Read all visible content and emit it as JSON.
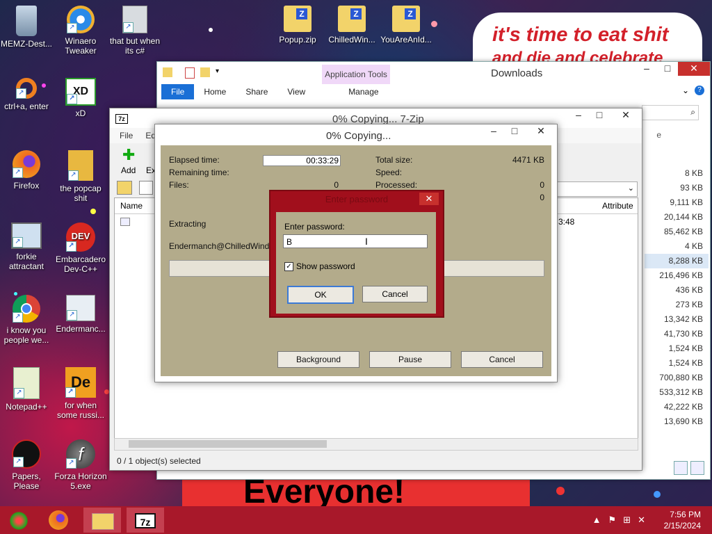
{
  "desktop": {
    "icons": [
      {
        "label": "MEMZ-Dest..."
      },
      {
        "label": "Winaero Tweaker"
      },
      {
        "label": "that but when its c#"
      },
      {
        "label": "Popup.zip"
      },
      {
        "label": "ChilledWin..."
      },
      {
        "label": "YouAreAnId..."
      },
      {
        "label": "ctrl+a, enter"
      },
      {
        "label": "xD"
      },
      {
        "label": "Firefox"
      },
      {
        "label": "the popcap shit"
      },
      {
        "label": "forkie attractant"
      },
      {
        "label": "Embarcadero Dev-C++"
      },
      {
        "label": "i know you people we..."
      },
      {
        "label": "Endermanc..."
      },
      {
        "label": "Notepad++"
      },
      {
        "label": "for when some russi..."
      },
      {
        "label": "Papers, Please"
      },
      {
        "label": "Forza Horizon 5.exe"
      }
    ],
    "banner_top_line1": "it's time to eat shit",
    "banner_top_line2": "and die and celebrate",
    "banner_bottom": "Everyone!"
  },
  "explorer": {
    "title": "Downloads",
    "context_tab": "Application Tools",
    "ribbon_tabs": [
      "File",
      "Home",
      "Share",
      "View",
      "Manage"
    ],
    "column_size_header": "e",
    "column_attr_header": "Attribute",
    "date_fragment": "3:48",
    "sizes": [
      "8 KB",
      "93 KB",
      "9,111 KB",
      "20,144 KB",
      "85,462 KB",
      "4 KB",
      "8,288 KB",
      "216,496 KB",
      "436 KB",
      "273 KB",
      "13,342 KB",
      "41,730 KB",
      "1,524 KB",
      "1,524 KB",
      "700,880 KB",
      "533,312 KB",
      "42,222 KB",
      "13,690 KB"
    ]
  },
  "zip_main": {
    "title": "0% Copying... 7-Zip",
    "logo": "7z",
    "menu": [
      "File",
      "Edit"
    ],
    "toolbar": {
      "add": "Add",
      "extract": "Ext"
    },
    "column_name": "Name",
    "status": "0 / 1 object(s) selected"
  },
  "progress": {
    "title": "0% Copying...",
    "elapsed_label": "Elapsed time:",
    "elapsed_value": "00:33:29",
    "remaining_label": "Remaining time:",
    "files_label": "Files:",
    "files_value": "0",
    "total_size_label": "Total size:",
    "total_size_value": "4471 KB",
    "speed_label": "Speed:",
    "processed_label": "Processed:",
    "processed_value": "0",
    "processed_value2": "0",
    "extracting_label": "Extracting",
    "extracting_path": "Endermanch@ChilledWindows",
    "buttons": {
      "background": "Background",
      "pause": "Pause",
      "cancel": "Cancel"
    }
  },
  "password_dialog": {
    "title": "Enter password",
    "label": "Enter password:",
    "value": "B",
    "show_password": "Show password",
    "ok": "OK",
    "cancel": "Cancel"
  },
  "taskbar": {
    "time": "7:56 PM",
    "date": "2/15/2024"
  }
}
